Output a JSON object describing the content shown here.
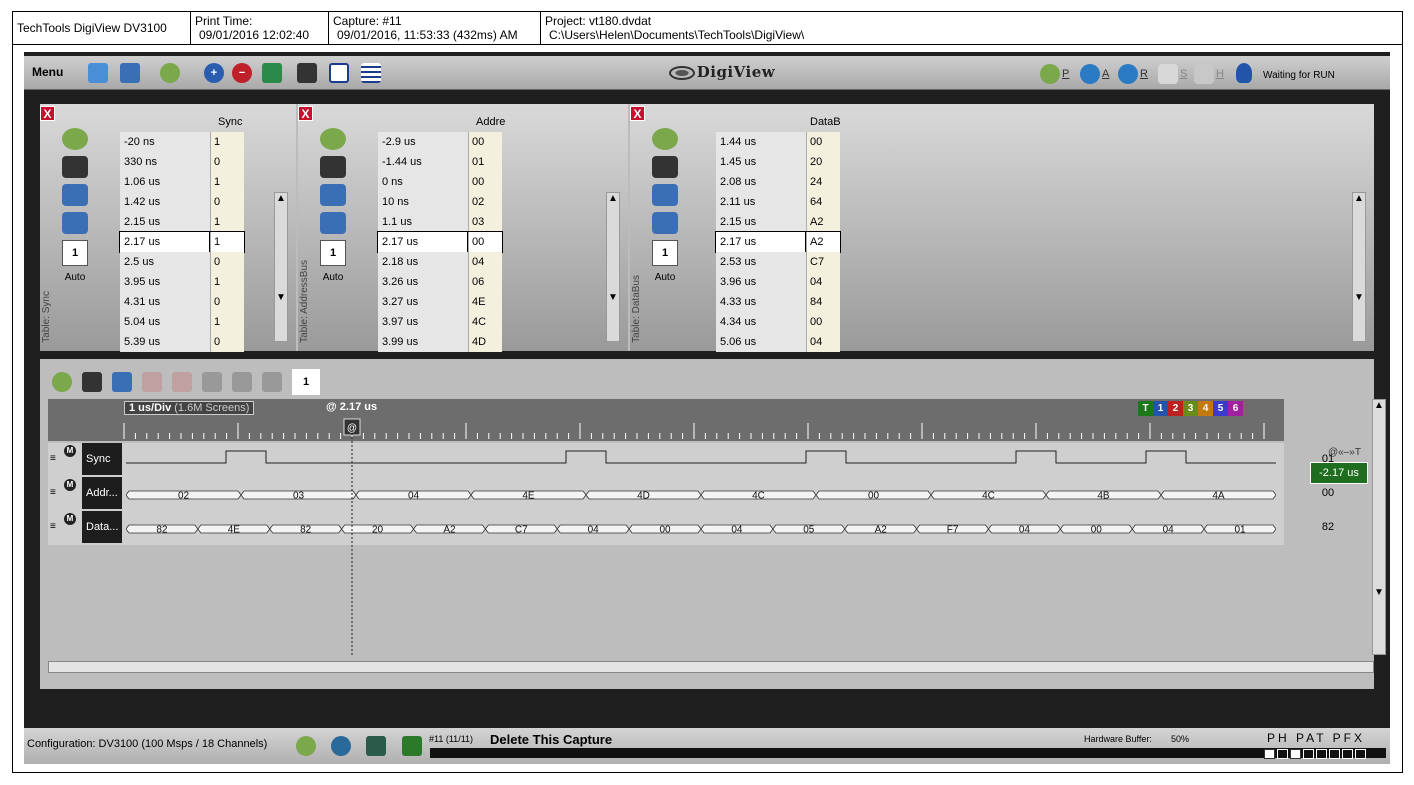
{
  "header": {
    "app_title": "TechTools DigiView DV3100",
    "print_time_label": "Print Time:",
    "print_time_value": "09/01/2016 12:02:40",
    "capture_label": "Capture:",
    "capture_num": "#11",
    "capture_value": "09/01/2016, 11:53:33 (432ms) AM",
    "project_label": "Project:",
    "project_file": "vt180.dvdat",
    "project_path": "C:\\Users\\Helen\\Documents\\TechTools\\DigiView\\"
  },
  "toolbar": {
    "menu_label": "Menu",
    "logo_text": "DigiView",
    "run_p": "P",
    "run_a": "A",
    "run_r": "R",
    "run_s": "S",
    "run_h": "H",
    "status": "Waiting for RUN"
  },
  "tables": {
    "sync": {
      "header": "Sync",
      "label": "Table: Sync",
      "num": "1",
      "auto": "Auto",
      "rows": [
        [
          "-20 ns",
          "1"
        ],
        [
          "330 ns",
          "0"
        ],
        [
          "1.06 us",
          "1"
        ],
        [
          "1.42 us",
          "0"
        ],
        [
          "2.15 us",
          "1"
        ],
        [
          "2.17 us",
          "1"
        ],
        [
          "2.5 us",
          "0"
        ],
        [
          "3.95 us",
          "1"
        ],
        [
          "4.31 us",
          "0"
        ],
        [
          "5.04 us",
          "1"
        ],
        [
          "5.39 us",
          "0"
        ]
      ]
    },
    "addr": {
      "header": "Addre",
      "label": "Table: AddressBus",
      "num": "1",
      "auto": "Auto",
      "rows": [
        [
          "-2.9 us",
          "00"
        ],
        [
          "-1.44 us",
          "01"
        ],
        [
          "0 ns",
          "00"
        ],
        [
          "10 ns",
          "02"
        ],
        [
          "1.1 us",
          "03"
        ],
        [
          "2.17 us",
          "00"
        ],
        [
          "2.18 us",
          "04"
        ],
        [
          "3.26 us",
          "06"
        ],
        [
          "3.27 us",
          "4E"
        ],
        [
          "3.97 us",
          "4C"
        ],
        [
          "3.99 us",
          "4D"
        ]
      ]
    },
    "data": {
      "header": "DataB",
      "label": "Table: DataBus",
      "num": "1",
      "auto": "Auto",
      "rows": [
        [
          "1.44 us",
          "00"
        ],
        [
          "1.45 us",
          "20"
        ],
        [
          "2.08 us",
          "24"
        ],
        [
          "2.11 us",
          "64"
        ],
        [
          "2.15 us",
          "A2"
        ],
        [
          "2.17 us",
          "A2"
        ],
        [
          "2.53 us",
          "C7"
        ],
        [
          "3.96 us",
          "04"
        ],
        [
          "4.33 us",
          "84"
        ],
        [
          "4.34 us",
          "00"
        ],
        [
          "5.06 us",
          "04"
        ]
      ]
    }
  },
  "waveform": {
    "toolbar_num": "1",
    "div_label": "1 us/Div",
    "div_screens": "(1.6M Screens)",
    "at_label": "@ 2.17 us",
    "cursor_marker": "@",
    "trig_tags": [
      "T",
      "1",
      "2",
      "3",
      "4",
      "5",
      "6"
    ],
    "trig_colors": [
      "#1a7a1a",
      "#2255aa",
      "#c02020",
      "#6a8a1a",
      "#c07a10",
      "#3a3acc",
      "#a020a0"
    ],
    "cursor_label": "@«–»T",
    "cursor_value": "-2.17 us",
    "channels": [
      {
        "name": "Sync",
        "value": "01"
      },
      {
        "name": "Addr...",
        "value": "00"
      },
      {
        "name": "Data...",
        "value": "82"
      }
    ],
    "addr_segments": [
      "02",
      "03",
      "04",
      "4E",
      "4D",
      "4C",
      "00",
      "4C",
      "4B",
      "4A"
    ],
    "data_segments": [
      "82",
      "4E",
      "82",
      "20",
      "A2",
      "C7",
      "04",
      "00",
      "04",
      "05",
      "A2",
      "F7",
      "04",
      "00",
      "04",
      "01"
    ]
  },
  "statusbar": {
    "config": "Configuration:  DV3100 (100 Msps / 18 Channels)",
    "capture_count": "#11 (11/11)",
    "delete_label": "Delete This Capture",
    "hw_buffer_label": "Hardware Buffer:",
    "hw_buffer_pct": "50%",
    "phat_flags": "PH PAT PFX"
  }
}
